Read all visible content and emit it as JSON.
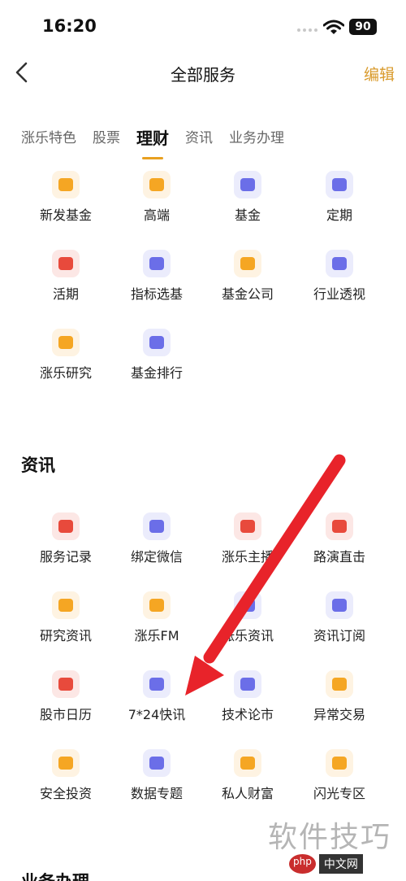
{
  "status": {
    "time": "16:20",
    "battery": "90"
  },
  "nav": {
    "title": "全部服务",
    "edit": "编辑"
  },
  "tabs": [
    {
      "label": "涨乐特色",
      "active": false
    },
    {
      "label": "股票",
      "active": false
    },
    {
      "label": "理财",
      "active": true
    },
    {
      "label": "资讯",
      "active": false
    },
    {
      "label": "业务办理",
      "active": false
    }
  ],
  "finance": {
    "items": [
      {
        "label": "新发基金",
        "icon": "new-fund-icon",
        "color": "#f5a623"
      },
      {
        "label": "高端",
        "icon": "diamond-icon",
        "color": "#f5a623"
      },
      {
        "label": "基金",
        "icon": "fund-icon",
        "color": "#6b6ee8"
      },
      {
        "label": "定期",
        "icon": "fixed-term-icon",
        "color": "#6b6ee8"
      },
      {
        "label": "活期",
        "icon": "yuan-coin-icon",
        "color": "#e84a3c"
      },
      {
        "label": "指标选基",
        "icon": "filter-icon",
        "color": "#6b6ee8"
      },
      {
        "label": "基金公司",
        "icon": "building-icon",
        "color": "#f5a623"
      },
      {
        "label": "行业透视",
        "icon": "industry-chart-icon",
        "color": "#6b6ee8"
      },
      {
        "label": "涨乐研究",
        "icon": "book-icon",
        "color": "#f5a623"
      },
      {
        "label": "基金排行",
        "icon": "ranking-icon",
        "color": "#6b6ee8"
      }
    ]
  },
  "news": {
    "title": "资讯",
    "items": [
      {
        "label": "服务记录",
        "icon": "heart-icon",
        "color": "#e84a3c"
      },
      {
        "label": "绑定微信",
        "icon": "wechat-icon",
        "color": "#6b6ee8"
      },
      {
        "label": "涨乐主播",
        "icon": "anchor-icon",
        "color": "#e84a3c"
      },
      {
        "label": "路演直击",
        "icon": "roadshow-icon",
        "color": "#e84a3c"
      },
      {
        "label": "研究资讯",
        "icon": "research-doc-icon",
        "color": "#f5a623"
      },
      {
        "label": "涨乐FM",
        "icon": "radio-icon",
        "color": "#f5a623"
      },
      {
        "label": "涨乐资讯",
        "icon": "news-icon",
        "color": "#6b6ee8"
      },
      {
        "label": "资讯订阅",
        "icon": "subscribe-icon",
        "color": "#6b6ee8"
      },
      {
        "label": "股市日历",
        "icon": "calendar-icon",
        "color": "#e84a3c"
      },
      {
        "label": "7*24快讯",
        "icon": "flash-news-icon",
        "color": "#6b6ee8"
      },
      {
        "label": "技术论市",
        "icon": "pen-icon",
        "color": "#6b6ee8"
      },
      {
        "label": "异常交易",
        "icon": "alert-coin-icon",
        "color": "#f5a623"
      },
      {
        "label": "安全投资",
        "icon": "shield-icon",
        "color": "#f5a623"
      },
      {
        "label": "数据专题",
        "icon": "data-chart-icon",
        "color": "#6b6ee8"
      },
      {
        "label": "私人财富",
        "icon": "wealth-icon",
        "color": "#f5a623"
      },
      {
        "label": "闪光专区",
        "icon": "star-icon",
        "color": "#f5a623"
      }
    ]
  },
  "business": {
    "title": "业务办理"
  },
  "watermark": {
    "text": "软件技巧",
    "php": "php",
    "cn": "中文网"
  },
  "annotation_arrow_color": "#e8232a"
}
